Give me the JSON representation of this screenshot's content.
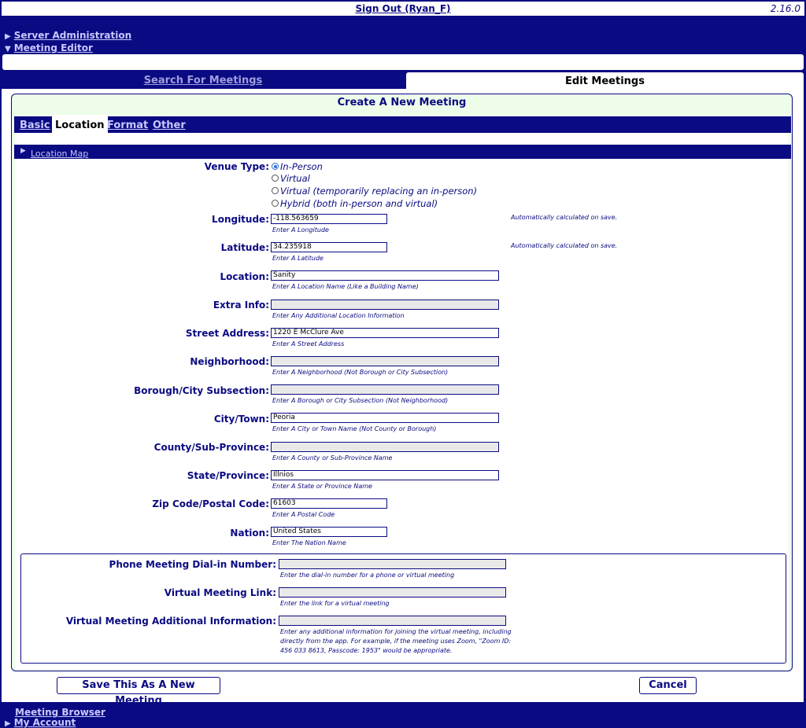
{
  "topbar": {
    "signout": "Sign Out (Ryan_F)",
    "version": "2.16.0"
  },
  "nav": {
    "server_admin": "Server Administration",
    "meeting_editor": "Meeting Editor"
  },
  "tabs": {
    "search": "Search For Meetings",
    "edit": "Edit Meetings"
  },
  "form_title": "Create A New Meeting",
  "subtabs": {
    "basic": "Basic",
    "location": "Location",
    "format": "Format",
    "other": "Other"
  },
  "location_map": "Location Map",
  "venue": {
    "label": "Venue Type:",
    "options": [
      "In-Person",
      "Virtual",
      "Virtual (temporarily replacing an in-person)",
      "Hybrid (both in-person and virtual)"
    ],
    "selected": "In-Person"
  },
  "fields": {
    "longitude": {
      "label": "Longitude:",
      "value": "-118.563659",
      "hint": "Enter A Longitude",
      "note": "Automatically calculated on save."
    },
    "latitude": {
      "label": "Latitude:",
      "value": "34.235918",
      "hint": "Enter A Latitude",
      "note": "Automatically calculated on save."
    },
    "location": {
      "label": "Location:",
      "value": "Sanity",
      "hint": "Enter A Location Name (Like a Building Name)"
    },
    "extra_info": {
      "label": "Extra Info:",
      "value": "",
      "hint": "Enter Any Additional Location Information"
    },
    "street": {
      "label": "Street Address:",
      "value": "1220 E McClure Ave",
      "hint": "Enter A Street Address"
    },
    "neighborhood": {
      "label": "Neighborhood:",
      "value": "",
      "hint": "Enter A Neighborhood (Not Borough or City Subsection)"
    },
    "borough": {
      "label": "Borough/City Subsection:",
      "value": "",
      "hint": "Enter A Borough or City Subsection (Not Neighborhood)"
    },
    "city": {
      "label": "City/Town:",
      "value": "Peoria",
      "hint": "Enter A City or Town Name (Not County or Borough)"
    },
    "county": {
      "label": "County/Sub-Province:",
      "value": "",
      "hint": "Enter A County or Sub-Province Name"
    },
    "state": {
      "label": "State/Province:",
      "value": "Illnios",
      "hint": "Enter A State or Province Name"
    },
    "zip": {
      "label": "Zip Code/Postal Code:",
      "value": "61603",
      "hint": "Enter A Postal Code"
    },
    "nation": {
      "label": "Nation:",
      "value": "United States",
      "hint": "Enter The Nation Name"
    }
  },
  "virtual": {
    "phone": {
      "label": "Phone Meeting Dial-in Number:",
      "value": "",
      "hint": "Enter the dial-in number for a phone or virtual meeting"
    },
    "link": {
      "label": "Virtual Meeting Link:",
      "value": "",
      "hint": "Enter the link for a virtual meeting"
    },
    "additional": {
      "label": "Virtual Meeting Additional Information:",
      "value": "",
      "hint_lines": [
        "Enter any additional information for joining the virtual meeting, including",
        "directly from the app. For example, if the meeting uses Zoom, \"Zoom ID:",
        "456 033 8613, Passcode: 1953\" would be appropriate."
      ]
    }
  },
  "buttons": {
    "save": "Save This As A New Meeting",
    "cancel": "Cancel"
  },
  "footer": {
    "meeting_browser": "Meeting Browser",
    "my_account": "My Account"
  },
  "colors": {
    "navy": "#0a0a82",
    "panel_green": "#edfdea",
    "link_light": "#c8c8ff"
  }
}
